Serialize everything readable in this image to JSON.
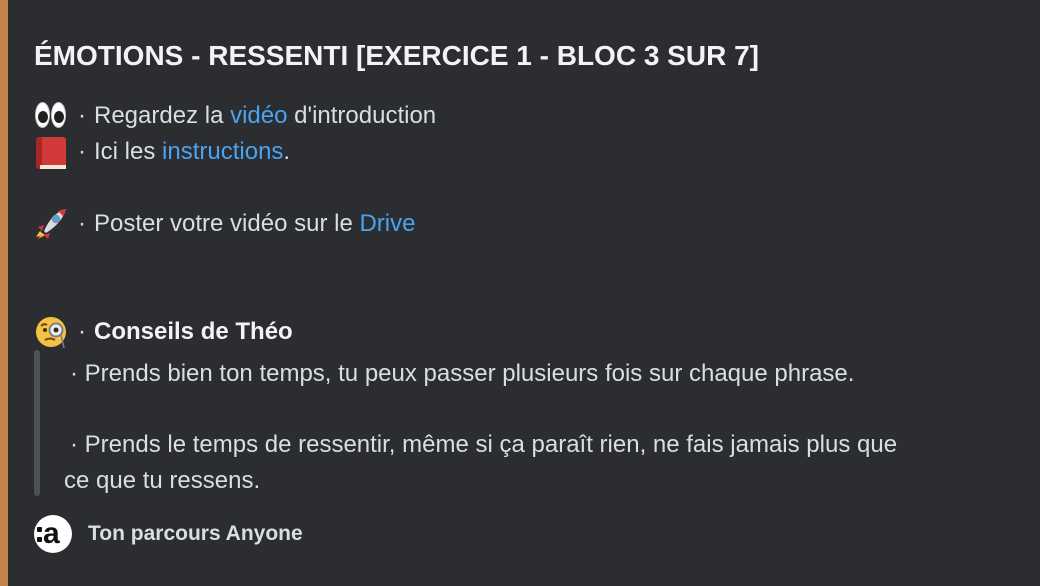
{
  "embed": {
    "accent_color": "#c4834a",
    "title": "ÉMOTIONS - RESSENTI [EXERCICE 1 - BLOC 3 SUR 7]",
    "lines": [
      {
        "icon": "eyes-icon",
        "sep": "·",
        "before": "Regardez la",
        "link": "vidéo",
        "after": "d'introduction"
      },
      {
        "icon": "book-icon",
        "sep": "·",
        "before": "Ici les",
        "link": "instructions",
        "after": "."
      },
      {
        "icon": "rocket-icon",
        "sep": "·",
        "before": "Poster votre vidéo sur le",
        "link": "Drive",
        "after": ""
      }
    ],
    "tips": {
      "icon": "monocle-face-icon",
      "sep": "·",
      "heading": "Conseils de Théo",
      "items": [
        "· Prends bien ton temps, tu peux passer plusieurs fois sur chaque phrase.",
        "· Prends le temps de ressentir, même si ça paraît rien, ne fais jamais plus que",
        "ce que tu ressens."
      ]
    },
    "footer": {
      "icon": "anyone-logo-icon",
      "text": "Ton parcours Anyone"
    }
  }
}
